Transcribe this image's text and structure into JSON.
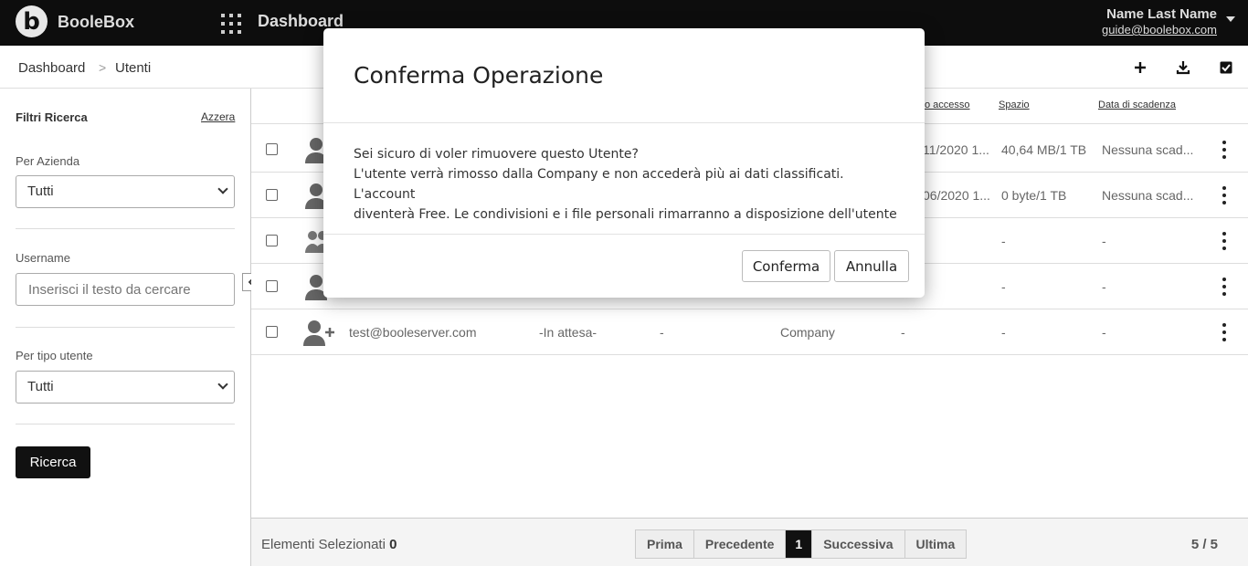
{
  "topbar": {
    "logo_letter": "b",
    "brand": "BooleBox",
    "title": "Dashboard",
    "user_name": "Name Last Name",
    "user_email": "guide@boolebox.com"
  },
  "breadcrumb": {
    "root": "Dashboard",
    "separator": ">",
    "current": "Utenti"
  },
  "toolbar": {
    "add_icon": "plus-icon",
    "download_icon": "download-icon",
    "select_icon": "checkbox-checked-icon"
  },
  "sidebar": {
    "title": "Filtri Ricerca",
    "reset": "Azzera",
    "company_label": "Per Azienda",
    "company_value": "Tutti",
    "username_label": "Username",
    "username_placeholder": "Inserisci il testo da cercare",
    "usertype_label": "Per tipo utente",
    "usertype_value": "Tutti",
    "search_button": "Ricerca"
  },
  "table": {
    "headers": {
      "last_access": "o accesso",
      "space": "Spazio",
      "expiry": "Data di scadenza"
    },
    "rows": [
      {
        "icon": "user-icon",
        "last_access": "11/2020 1...",
        "space": "40,64 MB/1 TB",
        "expiry": "Nessuna scad..."
      },
      {
        "icon": "user-icon",
        "last_access": "06/2020 1...",
        "space": "0 byte/1 TB",
        "expiry": "Nessuna scad..."
      },
      {
        "icon": "user-group-icon",
        "last_access": "",
        "space": "-",
        "expiry": "-"
      },
      {
        "icon": "user-icon",
        "last_access": "",
        "space": "-",
        "expiry": "-"
      },
      {
        "icon": "user-add-icon",
        "username": "test@booleserver.com",
        "status": "-In attesa-",
        "col3": "-",
        "type": "Company",
        "last_access": "-",
        "space": "-",
        "expiry": "-"
      }
    ]
  },
  "footer": {
    "selected_label": "Elementi Selezionati",
    "selected_count": "0",
    "pager": [
      "Prima",
      "Precedente",
      "1",
      "Successiva",
      "Ultima"
    ],
    "total": "5 / 5"
  },
  "modal": {
    "title": "Conferma Operazione",
    "line1": "Sei sicuro di voler rimuovere questo Utente?",
    "line2": "L'utente verrà rimosso dalla Company e non accederà più ai dati classificati. L'account",
    "line3": "diventerà Free. Le condivisioni e i file personali rimarranno a disposizione dell'utente",
    "confirm": "Conferma",
    "cancel": "Annulla"
  }
}
